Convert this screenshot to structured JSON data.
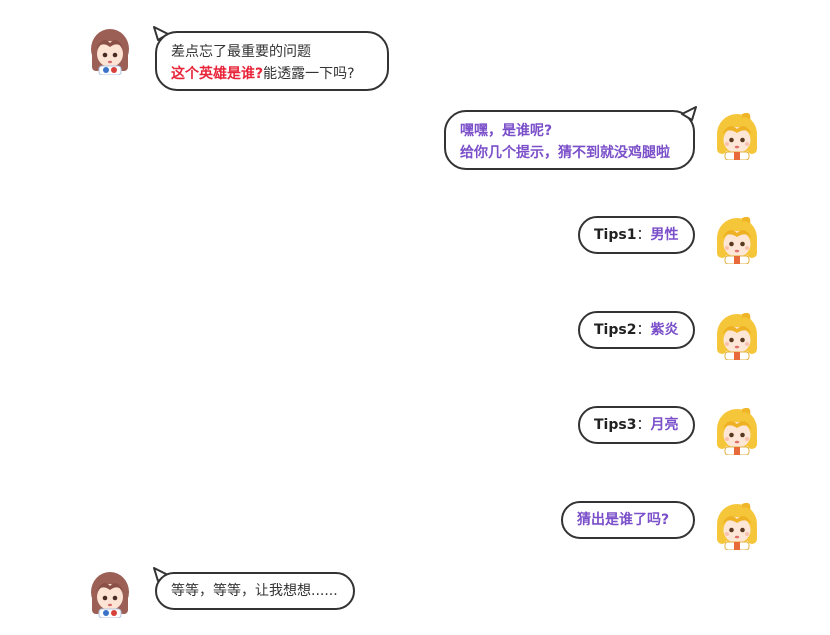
{
  "messages": [
    {
      "side": "left",
      "line1": "差点忘了最重要的问题",
      "line2_highlight": "这个英雄是谁?",
      "line2_rest": "能透露一下吗?"
    },
    {
      "side": "right",
      "line1": "嘿嘿，是谁呢?",
      "line2": "给你几个提示，猜不到就没鸡腿啦"
    },
    {
      "side": "right",
      "tip_label": "Tips1",
      "sep": "：",
      "tip_value": "男性"
    },
    {
      "side": "right",
      "tip_label": "Tips2",
      "sep": "：",
      "tip_value": "紫炎"
    },
    {
      "side": "right",
      "tip_label": "Tips3",
      "sep": "：",
      "tip_value": "月亮"
    },
    {
      "side": "right",
      "text": "猜出是谁了吗?"
    },
    {
      "side": "left",
      "text": "等等，等等，让我想想......"
    }
  ],
  "colors": {
    "highlight_red": "#e8253a",
    "highlight_purple": "#7a4fc9",
    "bubble_border": "#333333",
    "left_avatar_hair": "#a0645a",
    "right_avatar_hair": "#f5c531"
  },
  "avatars": {
    "left": "brown-hair-girl-avatar-icon",
    "right": "blonde-girl-avatar-icon"
  }
}
